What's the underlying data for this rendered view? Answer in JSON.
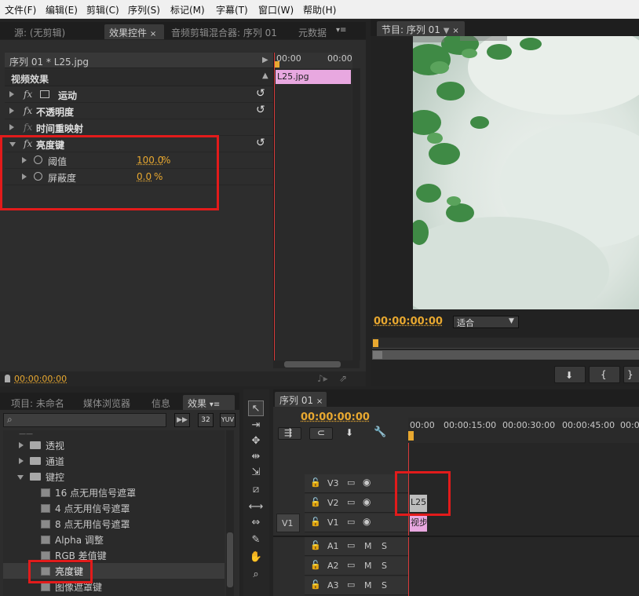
{
  "menu": [
    "文件(F)",
    "编辑(E)",
    "剪辑(C)",
    "序列(S)",
    "标记(M)",
    "字幕(T)",
    "窗口(W)",
    "帮助(H)"
  ],
  "source_panel": {
    "tabs": [
      "源: (无剪辑)",
      "效果控件",
      "音频剪辑混合器: 序列 01",
      "元数据"
    ],
    "active_tab_close": "×",
    "clip_header": "序列 01 * L25.jpg",
    "section_title": "视频效果",
    "effects": [
      {
        "name": "运动"
      },
      {
        "name": "不透明度"
      },
      {
        "name": "时间重映射"
      },
      {
        "name": "亮度键"
      }
    ],
    "params": [
      {
        "name": "阈值",
        "value": "100.0",
        "unit": "%"
      },
      {
        "name": "屏蔽度",
        "value": "0.0",
        "unit": "%"
      }
    ],
    "mini_timeline": {
      "start": "00:00",
      "end": "00:00",
      "clip": "L25.jpg"
    },
    "timecode": "00:00:00:00"
  },
  "program_panel": {
    "tab": "节目: 序列 01",
    "timecode": "00:00:00:00",
    "fit": "适合",
    "brand_colors": {
      "leaf": "#3f8a45",
      "mist": "#dfe7e3"
    }
  },
  "project_panel": {
    "tabs": [
      "项目: 未命名",
      "媒体浏览器",
      "信息",
      "效果"
    ],
    "toolbar_badges": [
      "32",
      "YUV"
    ],
    "tree": [
      {
        "label": "透视",
        "type": "folder",
        "expanded": false
      },
      {
        "label": "通道",
        "type": "folder",
        "expanded": false
      },
      {
        "label": "键控",
        "type": "folder",
        "expanded": true
      },
      {
        "label": "16 点无用信号遮罩",
        "type": "preset"
      },
      {
        "label": "4 点无用信号遮罩",
        "type": "preset"
      },
      {
        "label": "8 点无用信号遮罩",
        "type": "preset"
      },
      {
        "label": "Alpha 调整",
        "type": "preset"
      },
      {
        "label": "RGB 差值键",
        "type": "preset"
      },
      {
        "label": "亮度键",
        "type": "preset"
      },
      {
        "label": "图像遮罩键",
        "type": "preset"
      }
    ]
  },
  "timeline": {
    "tab": "序列 01",
    "timecode": "00:00:00:00",
    "ruler": [
      "00:00",
      "00:00:15:00",
      "00:00:30:00",
      "00:00:45:00",
      "00:0"
    ],
    "video_tracks": [
      "V3",
      "V2",
      "V1"
    ],
    "source_patch": "V1",
    "audio_tracks": [
      "A1",
      "A2",
      "A3"
    ],
    "clips": {
      "v2": "L25",
      "v1": "视步"
    },
    "audio_buttons": [
      "M",
      "S"
    ]
  }
}
